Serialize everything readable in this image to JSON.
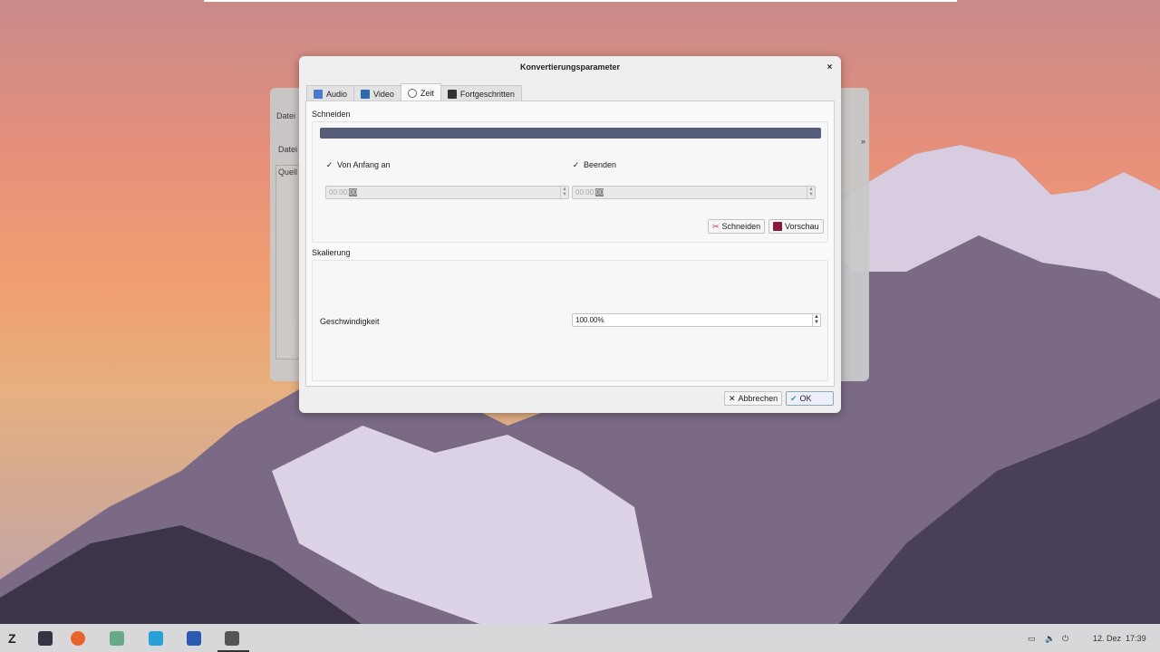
{
  "background_window": {
    "menu_label": "Datei",
    "row_label": "Datei",
    "pane_label": "Quell"
  },
  "dialog": {
    "title": "Konvertierungsparameter",
    "close_icon": "×",
    "tabs": [
      {
        "label": "Audio",
        "icon": "audio-icon"
      },
      {
        "label": "Video",
        "icon": "video-icon"
      },
      {
        "label": "Zeit",
        "icon": "clock-icon"
      },
      {
        "label": "Fortgeschritten",
        "icon": "terminal-icon"
      }
    ],
    "active_tab": "Zeit",
    "cut": {
      "section": "Schneiden",
      "from_start": {
        "label": "Von Anfang an",
        "checked": true,
        "value_prefix": "00:00:",
        "value_selected": "00"
      },
      "end": {
        "label": "Beenden",
        "checked": true,
        "value_prefix": "00:00:",
        "value_selected": "00"
      },
      "cut_button": "Schneiden",
      "preview_button": "Vorschau"
    },
    "scaling": {
      "section": "Skalierung",
      "speed_label": "Geschwindigkeit",
      "speed_value": "100.00%"
    },
    "cancel_button": "Abbrechen",
    "ok_button": "OK"
  },
  "taskbar": {
    "date": "12. Dez",
    "time": "17:39"
  },
  "colors": {
    "progress": "#565d7a"
  }
}
